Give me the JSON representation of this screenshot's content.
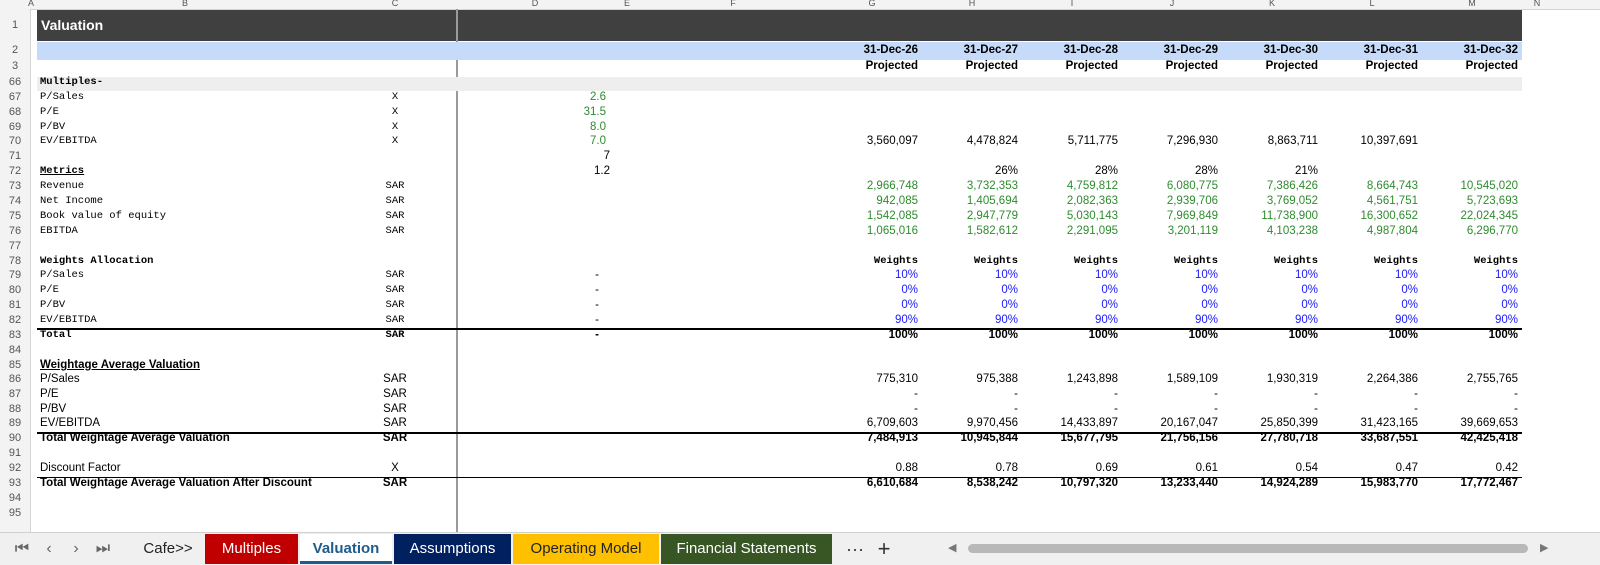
{
  "columns": [
    "A",
    "B",
    "C",
    "D",
    "E",
    "F",
    "G",
    "H",
    "I",
    "J",
    "K",
    "L",
    "M",
    "N"
  ],
  "title": "Valuation",
  "dates": [
    "31-Dec-26",
    "31-Dec-27",
    "31-Dec-28",
    "31-Dec-29",
    "31-Dec-30",
    "31-Dec-31",
    "31-Dec-32"
  ],
  "proj": "Projected",
  "rownums": [
    "1",
    "2",
    "3",
    "66",
    "67",
    "68",
    "69",
    "70",
    "71",
    "72",
    "73",
    "74",
    "75",
    "76",
    "77",
    "78",
    "79",
    "80",
    "81",
    "82",
    "83",
    "84",
    "85",
    "86",
    "87",
    "88",
    "89",
    "90",
    "91",
    "92",
    "93",
    "94",
    "95"
  ],
  "multiples": {
    "header": "Multiples-",
    "rows": [
      {
        "label": "P/Sales",
        "unit": "X",
        "val": "2.6"
      },
      {
        "label": "P/E",
        "unit": "X",
        "val": "31.5"
      },
      {
        "label": "P/BV",
        "unit": "X",
        "val": "8.0"
      },
      {
        "label": "EV/EBITDA",
        "unit": "X",
        "val": "7.0"
      }
    ],
    "ev_vals": [
      "3,560,097",
      "4,478,824",
      "5,711,775",
      "7,296,930",
      "8,863,711",
      "10,397,691"
    ],
    "row71": "7",
    "row72": "1.2"
  },
  "metrics": {
    "header": "Metrics",
    "growth": [
      "26%",
      "28%",
      "28%",
      "21%"
    ],
    "rows": [
      {
        "label": "Revenue",
        "unit": "SAR",
        "vals": [
          "2,966,748",
          "3,732,353",
          "4,759,812",
          "6,080,775",
          "7,386,426",
          "8,664,743",
          "10,545,020"
        ]
      },
      {
        "label": "Net Income",
        "unit": "SAR",
        "vals": [
          "942,085",
          "1,405,694",
          "2,082,363",
          "2,939,706",
          "3,769,052",
          "4,561,751",
          "5,723,693"
        ]
      },
      {
        "label": "Book value of equity",
        "unit": "SAR",
        "vals": [
          "1,542,085",
          "2,947,779",
          "5,030,143",
          "7,969,849",
          "11,738,900",
          "16,300,652",
          "22,024,345"
        ]
      },
      {
        "label": "EBITDA",
        "unit": "SAR",
        "vals": [
          "1,065,016",
          "1,582,612",
          "2,291,095",
          "3,201,119",
          "4,103,238",
          "4,987,804",
          "6,296,770"
        ]
      }
    ]
  },
  "weights": {
    "header": "Weights Allocation",
    "col_label": "Weights",
    "rows": [
      {
        "label": "P/Sales",
        "unit": "SAR",
        "d": "-",
        "vals": [
          "10%",
          "10%",
          "10%",
          "10%",
          "10%",
          "10%",
          "10%"
        ]
      },
      {
        "label": "P/E",
        "unit": "SAR",
        "d": "-",
        "vals": [
          "0%",
          "0%",
          "0%",
          "0%",
          "0%",
          "0%",
          "0%"
        ]
      },
      {
        "label": "P/BV",
        "unit": "SAR",
        "d": "-",
        "vals": [
          "0%",
          "0%",
          "0%",
          "0%",
          "0%",
          "0%",
          "0%"
        ]
      },
      {
        "label": "EV/EBITDA",
        "unit": "SAR",
        "d": "-",
        "vals": [
          "90%",
          "90%",
          "90%",
          "90%",
          "90%",
          "90%",
          "90%"
        ]
      }
    ],
    "total": {
      "label": "Total",
      "unit": "SAR",
      "d": "-",
      "vals": [
        "100%",
        "100%",
        "100%",
        "100%",
        "100%",
        "100%",
        "100%"
      ]
    }
  },
  "wav": {
    "header": "Weightage Average Valuation",
    "rows": [
      {
        "label": "P/Sales",
        "unit": "SAR",
        "vals": [
          "775,310",
          "975,388",
          "1,243,898",
          "1,589,109",
          "1,930,319",
          "2,264,386",
          "2,755,765"
        ]
      },
      {
        "label": "P/E",
        "unit": "SAR",
        "vals": [
          "-",
          "-",
          "-",
          "-",
          "-",
          "-",
          "-"
        ]
      },
      {
        "label": "P/BV",
        "unit": "SAR",
        "vals": [
          "-",
          "-",
          "-",
          "-",
          "-",
          "-",
          "-"
        ]
      },
      {
        "label": "EV/EBITDA",
        "unit": "SAR",
        "vals": [
          "6,709,603",
          "9,970,456",
          "14,433,897",
          "20,167,047",
          "25,850,399",
          "31,423,165",
          "39,669,653"
        ]
      }
    ],
    "total": {
      "label": "Total Weightage Average Valuation",
      "unit": "SAR",
      "vals": [
        "7,484,913",
        "10,945,844",
        "15,677,795",
        "21,756,156",
        "27,780,718",
        "33,687,551",
        "42,425,418"
      ]
    },
    "discount": {
      "label": "Discount Factor",
      "unit": "X",
      "vals": [
        "0.88",
        "0.78",
        "0.69",
        "0.61",
        "0.54",
        "0.47",
        "0.42"
      ]
    },
    "after": {
      "label": "Total Weightage Average Valuation After Discount",
      "unit": "SAR",
      "vals": [
        "6,610,684",
        "8,538,242",
        "10,797,320",
        "13,233,440",
        "14,924,289",
        "15,983,770",
        "17,772,467"
      ]
    }
  },
  "tabs": {
    "items": [
      {
        "label": "Cafe>>",
        "bg": "#f0f0f0",
        "color": "#222"
      },
      {
        "label": "Multiples",
        "bg": "#c00000",
        "color": "#ffffff"
      },
      {
        "label": "Valuation",
        "bg": "#ffffff",
        "color": "#1f5c8c"
      },
      {
        "label": "Assumptions",
        "bg": "#002060",
        "color": "#ffffff"
      },
      {
        "label": "Operating Model",
        "bg": "#ffc000",
        "color": "#222222"
      },
      {
        "label": "Financial Statements",
        "bg": "#375623",
        "color": "#ffffff"
      }
    ],
    "more": "···",
    "add": "+"
  },
  "colors": {
    "header_dark": "#404040",
    "header_blue": "#c6dbf9",
    "green": "#2e8b2e",
    "blue": "#1a1aff"
  }
}
